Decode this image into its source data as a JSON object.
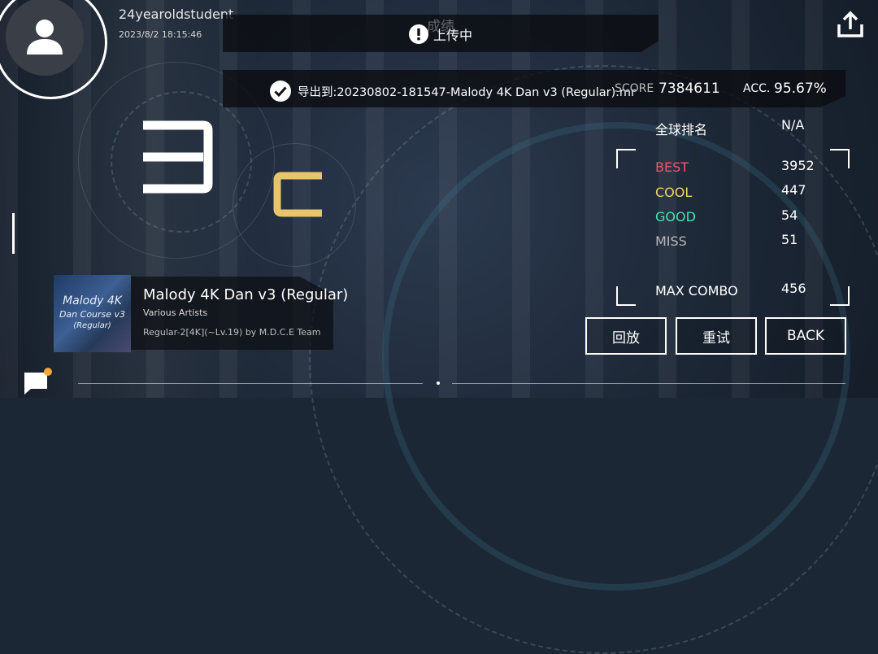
{
  "user": {
    "name": "24yearoldstudent",
    "datetime": "2023/8/2 18:15:46"
  },
  "banner_upload": {
    "title": "成绩",
    "status": "上传中"
  },
  "banner_export": {
    "text": "导出到:20230802-181547-Malody 4K Dan v3 (Regular).mr",
    "score_label": "SCORE",
    "score_value": "7384611",
    "acc_label": "ACC.",
    "acc_value": "95.67%"
  },
  "grade": {
    "number": "3",
    "letter": "C"
  },
  "stats": {
    "rank_label": "全球排名",
    "rank_value": "N/A",
    "best_label": "BEST",
    "best_value": "3952",
    "cool_label": "COOL",
    "cool_value": "447",
    "good_label": "GOOD",
    "good_value": "54",
    "miss_label": "MISS",
    "miss_value": "51",
    "combo_label": "MAX COMBO",
    "combo_value": "456"
  },
  "song": {
    "cover_line1": "Malody 4K",
    "cover_line2": "Dan Course v3",
    "cover_line3": "(Regular)",
    "title": "Malody 4K Dan v3 (Regular)",
    "artist": "Various Artists",
    "chart": "Regular-2[4K](~Lv.19) by M.D.C.E Team"
  },
  "buttons": {
    "replay": "回放",
    "retry": "重试",
    "back": "BACK"
  },
  "colors": {
    "best": "#f0576a",
    "cool": "#f2d36a",
    "good": "#4fe0b4",
    "miss": "#b7b7b7",
    "grade_letter": "#e8c56a",
    "notification_dot": "#f3a733"
  },
  "icons": {
    "avatar": "user-silhouette-icon",
    "upload": "upload-icon",
    "alert": "exclamation-circle-icon",
    "check": "check-circle-icon",
    "chat": "chat-bubble-icon"
  }
}
